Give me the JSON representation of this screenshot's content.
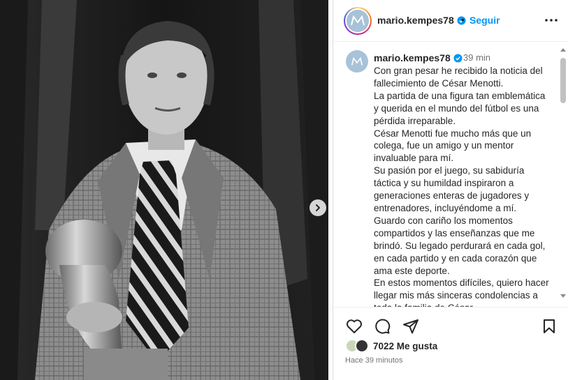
{
  "post": {
    "username": "mario.kempes78",
    "separator": "•",
    "follow_label": "Seguir",
    "time_ago": "39 min",
    "caption_lines": [
      "Con gran pesar he recibido la noticia del fallecimiento de César Menotti.",
      "La partida de una figura tan emblemática y querida en el mundo del fútbol es una pérdida irreparable.",
      "César Menotti fue mucho más que un colega, fue un amigo y un mentor invaluable para mí.",
      "Su pasión por el juego, su sabiduría táctica y su humildad inspiraron a generaciones enteras de jugadores y entrenadores, incluyéndome a mí.",
      "Guardo con cariño los momentos compartidos y las enseñanzas que me brindó. Su legado perdurará en cada gol, en cada partido y en cada corazón que ama este deporte.",
      "En estos momentos difíciles, quiero hacer llegar mis más sinceras condolencias a toda la familia de César."
    ],
    "likes": "7022 Me gusta",
    "timestamp": "Hace 39 minutos"
  },
  "colors": {
    "accent_blue": "#0095f6",
    "verified_blue": "#0095f6",
    "text": "#262626",
    "muted": "#737373"
  },
  "icons": {
    "like": "heart-icon",
    "comment": "comment-icon",
    "share": "send-icon",
    "save": "bookmark-icon",
    "more": "more-options-icon",
    "next": "chevron-right-icon"
  }
}
